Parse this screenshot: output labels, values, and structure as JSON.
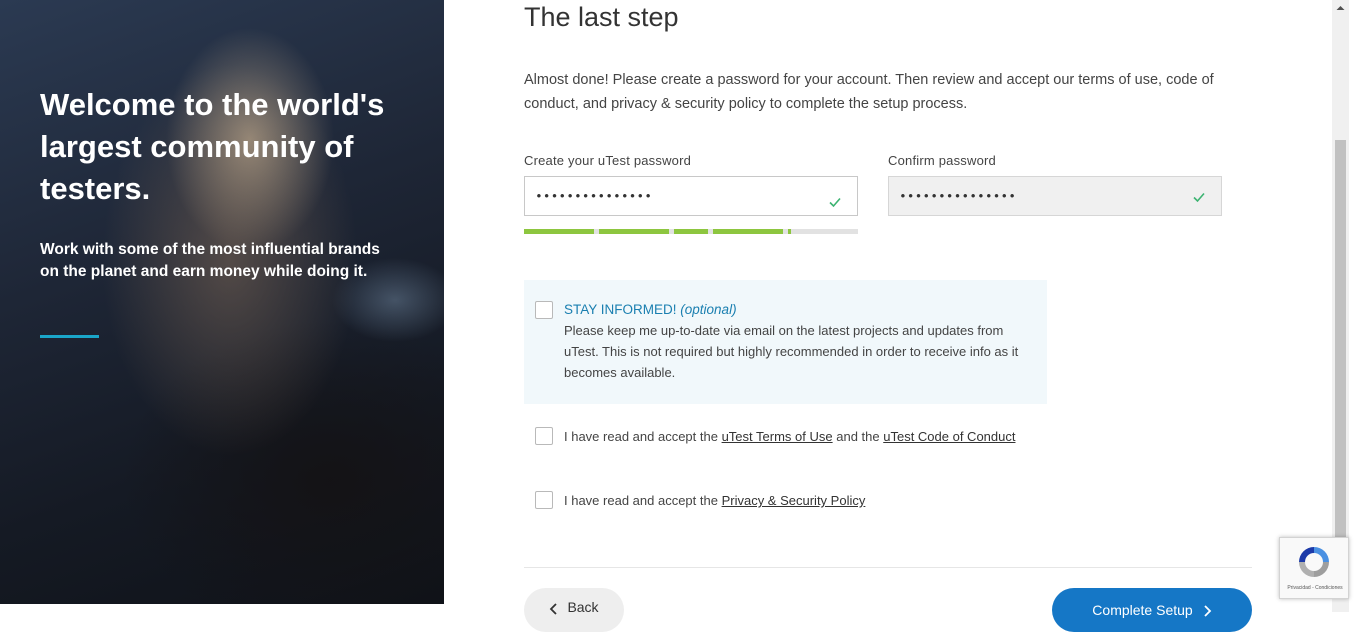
{
  "hero": {
    "title": "Welcome to the world's largest community of testers.",
    "subtitle": "Work with some of the most influential brands on the planet and earn money while doing it.",
    "accent_color": "#1aa6c9"
  },
  "step": {
    "title": "The last step",
    "intro": "Almost done! Please create a password for your account. Then review and accept our terms of use, code of conduct, and privacy & security policy to complete the setup process."
  },
  "password": {
    "label": "Create your uTest password",
    "value": "•••••••••••••••",
    "valid_icon": "check-icon",
    "strength_fraction": 0.8
  },
  "confirm": {
    "label": "Confirm password",
    "value": "•••••••••••••••",
    "valid_icon": "check-icon"
  },
  "informed": {
    "heading": "STAY INFORMED!",
    "optional": "(optional)",
    "body": "Please keep me up-to-date via email on the latest projects and updates from uTest. This is not required but highly recommended in order to receive info as it becomes available."
  },
  "terms": {
    "prefix": "I have read and accept the",
    "link1": "uTest Terms of Use",
    "middle": "and the",
    "link2": "uTest Code of Conduct"
  },
  "privacy": {
    "prefix": "I have read and accept the",
    "link": "Privacy & Security Policy"
  },
  "buttons": {
    "back": "Back",
    "complete": "Complete Setup"
  },
  "recaptcha": {
    "footer": "Privacidad - Condiciones"
  },
  "colors": {
    "strength": "#8dc63f",
    "primary": "#1577c6",
    "valid": "#3cb371"
  }
}
